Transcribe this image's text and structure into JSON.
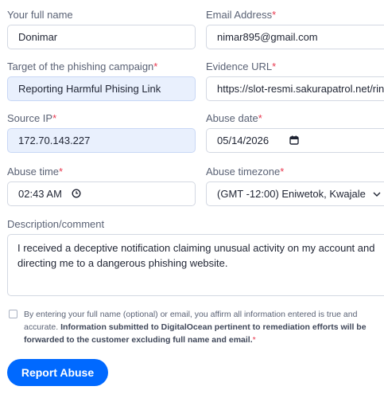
{
  "form": {
    "full_name": {
      "label": "Your full name",
      "value": "Donimar"
    },
    "email": {
      "label": "Email Address",
      "value": "nimar895@gmail.com",
      "required": "*"
    },
    "target": {
      "label": "Target of the phishing campaign",
      "value": "Reporting Harmful Phising Link",
      "required": "*"
    },
    "evidence_url": {
      "label": "Evidence URL",
      "value": "https://slot-resmi.sakurapatrol.net/rinse",
      "required": "*"
    },
    "source_ip": {
      "label": "Source IP",
      "value": "172.70.143.227",
      "required": "*"
    },
    "abuse_date": {
      "label": "Abuse date",
      "value": "05/14/2026",
      "required": "*",
      "icon": "calendar-icon"
    },
    "abuse_time": {
      "label": "Abuse time",
      "value": "02:43 AM",
      "required": "*",
      "icon": "clock-icon"
    },
    "abuse_timezone": {
      "label": "Abuse timezone",
      "value": "(GMT -12:00) Eniwetok, Kwajale",
      "required": "*",
      "icon": "chevron-down-icon"
    },
    "description": {
      "label": "Description/comment",
      "value": "I received a deceptive notification claiming unusual activity on my account and directing me to a dangerous phishing website."
    },
    "consent": {
      "text_plain": "By entering your full name (optional) or email, you affirm all information entered is true and accurate. ",
      "text_bold": "Information submitted to DigitalOcean pertinent to remediation efforts will be forwarded to the customer excluding full name and email.",
      "required": "*"
    },
    "submit_label": "Report Abuse"
  },
  "colors": {
    "accent": "#0069ff",
    "required": "#e8384f",
    "filled_bg": "#e9f0fd"
  }
}
